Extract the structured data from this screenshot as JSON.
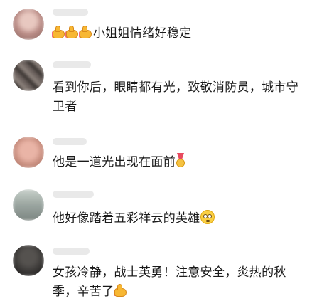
{
  "comments": [
    {
      "text_lead_emojis": [
        "thumbs-up",
        "thumbs-up",
        "thumbs-up"
      ],
      "text": "小姐姐情绪好稳定",
      "avatar_color": "#c9a6a0"
    },
    {
      "text": "看到你后，眼睛都有光，致敬消防员，城市守卫者",
      "avatar_color": "#5a5350"
    },
    {
      "text": "他是一道光出现在面前",
      "trailing_emoji": "medal",
      "avatar_color": "#d99a8a"
    },
    {
      "text": "他好像踏着五彩祥云的英雄",
      "trailing_emoji": "flushed-face",
      "avatar_color": "#9aa5a0"
    },
    {
      "text": "女孩冷静，战士英勇！注意安全，炎热的秋季，辛苦了",
      "trailing_emoji": "thumbs-up",
      "avatar_color": "#3d3b3a"
    }
  ]
}
